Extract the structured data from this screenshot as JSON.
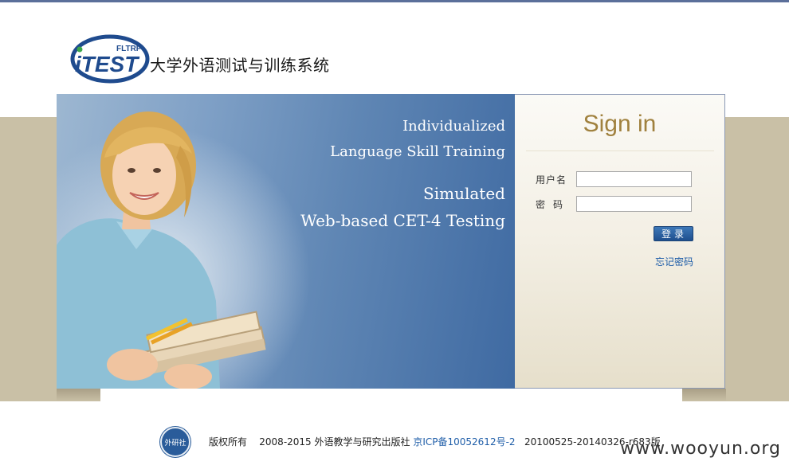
{
  "brand": {
    "logo_text": "iTEST",
    "logo_subtext": "FLTRP",
    "system_name": "大学外语测试与训练系统"
  },
  "hero": {
    "line1": "Individualized",
    "line2": "Language Skill Training",
    "line3": "Simulated",
    "line4": "Web-based CET-4 Testing"
  },
  "signin": {
    "title": "Sign in",
    "username_label": "用户名",
    "password_label": "密码",
    "username_value": "",
    "password_value": "",
    "login_button": "登录",
    "forgot_link": "忘记密码"
  },
  "footer": {
    "copyright": "版权所有",
    "publisher": "2008-2015 外语教学与研究出版社",
    "icp": "京ICP备10052612号-2",
    "version": "20100525-20140326-r683版",
    "seal_text": "外研社"
  },
  "watermark": "www.wooyun.org",
  "colors": {
    "accent": "#a0813e",
    "link": "#1e5da8",
    "band": "#c9c0a6",
    "button": "#2a5c9a"
  }
}
